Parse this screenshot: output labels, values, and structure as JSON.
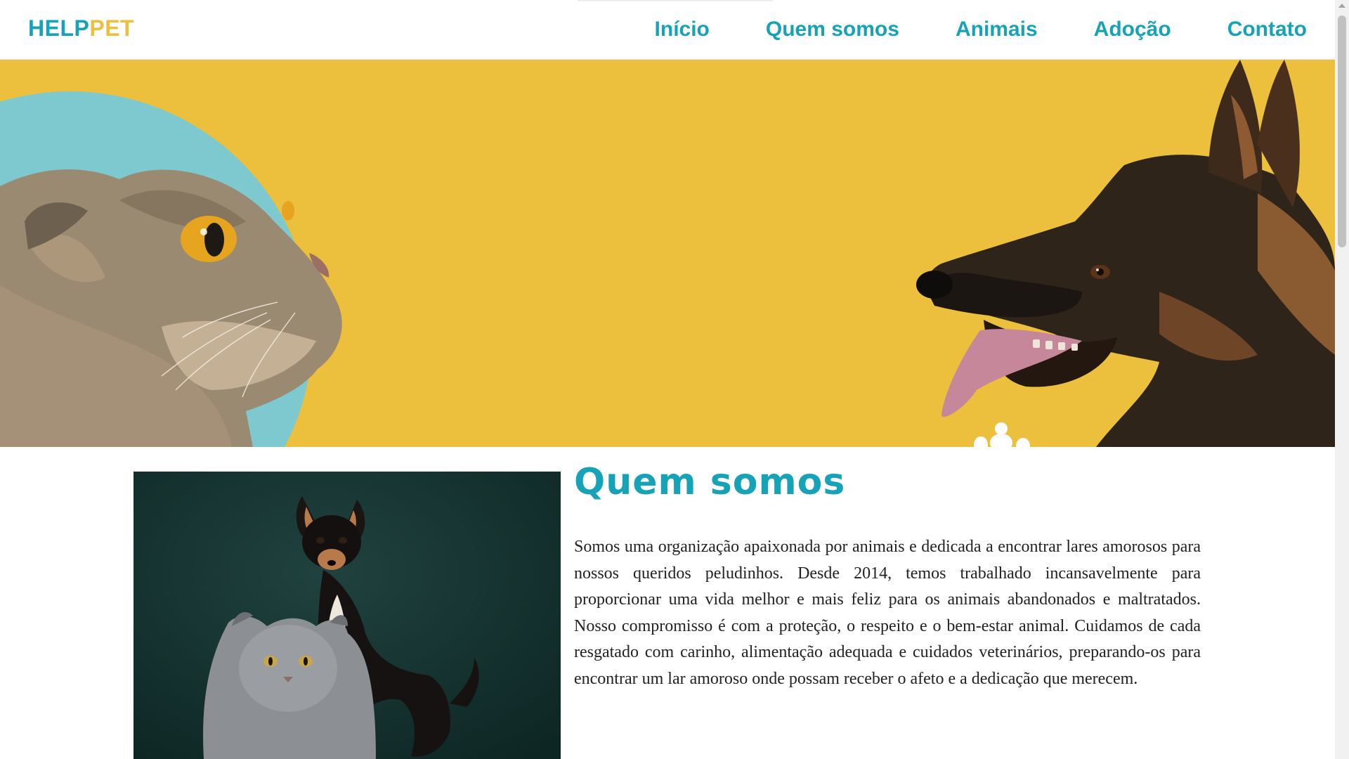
{
  "header": {
    "logo": {
      "part1": "HELP",
      "part2": "PET"
    },
    "nav": [
      {
        "label": "Início"
      },
      {
        "label": "Quem somos"
      },
      {
        "label": "Animais"
      },
      {
        "label": "Adoção"
      },
      {
        "label": "Contato"
      }
    ]
  },
  "hero": {
    "background_color": "#ecbf3c",
    "accent_color": "#7ec8cf",
    "left_image": "cat-photo",
    "right_image": "dog-photo",
    "decoration": "paw-print-icon"
  },
  "about": {
    "title": "Quem somos",
    "image": "dog-and-cat-photo",
    "paragraph": "Somos uma organização apaixonada por animais e dedicada a encontrar lares amorosos para nossos queridos peludinhos. Desde 2014, temos trabalhado incansavelmente para proporcionar uma vida melhor e mais feliz para os animais abandonados e maltratados. Nosso compromisso é com a proteção, o respeito e o bem-estar animal. Cuidamos de cada resgatado com carinho, alimentação adequada e cuidados veterinários, preparando-os para encontrar um lar amoroso onde possam receber o afeto e a dedicação que merecem."
  },
  "theme": {
    "primary": "#16a3b7",
    "secondary": "#ecbf3c",
    "text": "#222222"
  }
}
